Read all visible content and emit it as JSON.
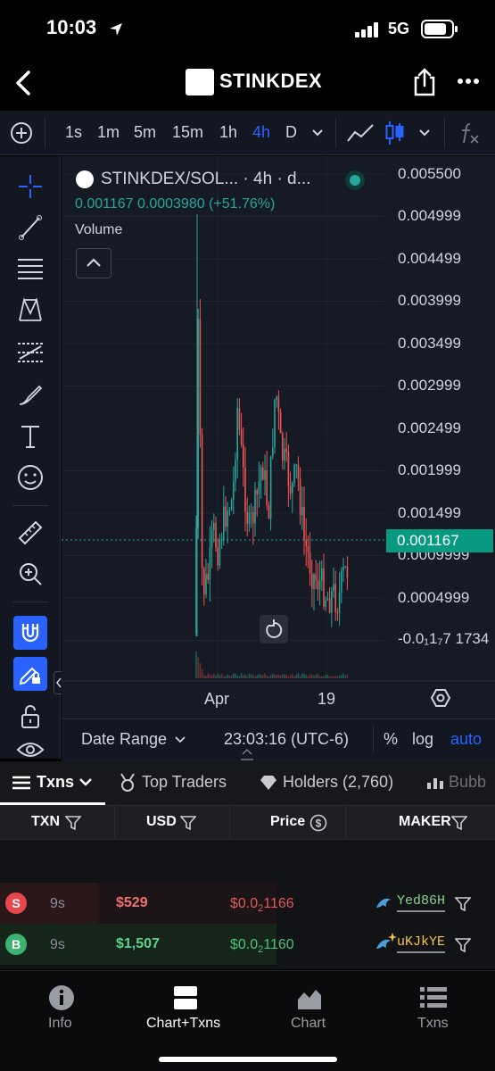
{
  "status_bar": {
    "time": "10:03",
    "network": "5G"
  },
  "header": {
    "title": "STINKDEX"
  },
  "toolbar": {
    "timeframes": [
      "1s",
      "1m",
      "5m",
      "15m",
      "1h",
      "4h",
      "D"
    ],
    "active_timeframe": "4h"
  },
  "chart": {
    "symbol_line": "STINKDEX/SOL... · 4h · d...",
    "ohlc": "0.001167  0.0003980 (+51.76%)",
    "volume_label": "Volume",
    "current_price": "0.001167",
    "y_axis": [
      "0.005500",
      "0.004999",
      "0.004499",
      "0.003999",
      "0.003499",
      "0.002999",
      "0.002499",
      "0.001999",
      "0.001499",
      "0.0009999",
      "0.0004999",
      "-0.0₁1₇7 1734"
    ],
    "x_axis": [
      "Apr",
      "19"
    ],
    "colors": {
      "up": "#26a69a",
      "down": "#ef5350",
      "background": "#161a25"
    }
  },
  "range_bar": {
    "date_range": "Date Range",
    "time": "23:03:16 (UTC-6)",
    "percent": "%",
    "log": "log",
    "auto": "auto"
  },
  "txn_tabs": {
    "txns": "Txns",
    "top_traders": "Top Traders",
    "holders": "Holders (2,760)",
    "bubble": "Bubb"
  },
  "table": {
    "headers": {
      "txn": "TXN",
      "usd": "USD",
      "price": "Price",
      "maker": "MAKER"
    },
    "rows": [
      {
        "type": "S",
        "age": "9s",
        "usd": "$529",
        "price_prefix": "$0.0",
        "price_sub": "2",
        "price_rest": "1166",
        "maker": "Yed86H"
      },
      {
        "type": "B",
        "age": "9s",
        "usd": "$1,507",
        "price_prefix": "$0.0",
        "price_sub": "2",
        "price_rest": "1160",
        "maker": "uKJkYE"
      }
    ]
  },
  "bottom_nav": {
    "info": "Info",
    "chart_txns": "Chart+Txns",
    "chart": "Chart",
    "txns": "Txns"
  }
}
